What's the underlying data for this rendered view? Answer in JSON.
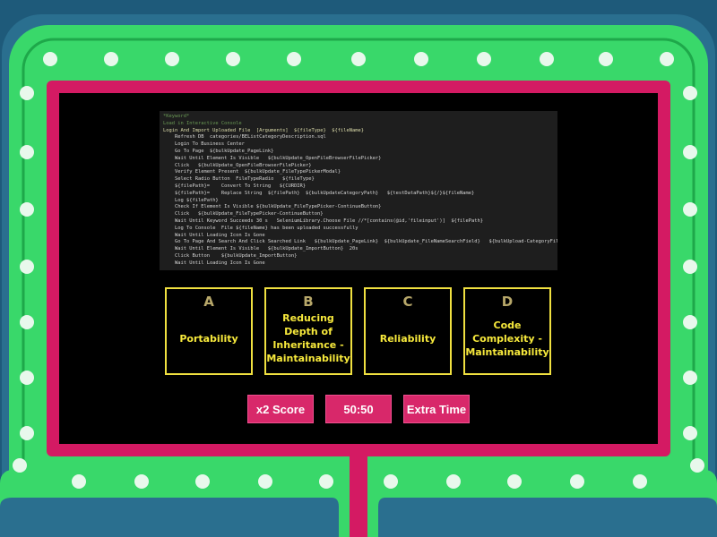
{
  "colors": {
    "background": "#1e5a7a",
    "outer_ring": "#2a6f8f",
    "green_ring": "#39d86a",
    "dark_green": "#1ea84a",
    "pink_frame": "#d41a63",
    "lights": "#e8f8ec",
    "answer_border": "#f0e040",
    "answer_text": "#f7e93c",
    "powerup": "#d8286a"
  },
  "question": {
    "code_lines": [
      {
        "text": "*Keyword*",
        "style": "c-green",
        "indent": 0
      },
      {
        "text": "Load in Interactive Console",
        "style": "c-green",
        "indent": 0
      },
      {
        "text": "Login And Import Uploaded File  [Arguments]  ${fileType}  ${fileName}",
        "style": "c-yellow",
        "indent": 0
      },
      {
        "text": "Refresh DB  categories/BEListCategoryDescription.sql",
        "style": "",
        "indent": 1
      },
      {
        "text": "Login To Business Center",
        "style": "",
        "indent": 1
      },
      {
        "text": "Go To Page  ${bulkUpdate_PageLink}",
        "style": "",
        "indent": 1
      },
      {
        "text": "Wait Until Element Is Visible   ${bulkUpdate_OpenFileBrowserFilePicker}",
        "style": "",
        "indent": 1
      },
      {
        "text": "Click   ${bulkUpdate_OpenFileBrowserFilePicker}",
        "style": "",
        "indent": 1
      },
      {
        "text": "Verify Element Present  ${bulkUpdate_FileTypePickerModal}",
        "style": "",
        "indent": 1
      },
      {
        "text": "Select Radio Button  FileTypeRadio   ${fileType}",
        "style": "",
        "indent": 1
      },
      {
        "text": "${filePath}=    Convert To String   ${CURDIR}",
        "style": "",
        "indent": 1
      },
      {
        "text": "${filePath}=    Replace String  ${filePath}  ${bulkUpdateCategoryPath}   ${testDataPath}${/}${fileName}",
        "style": "",
        "indent": 1
      },
      {
        "text": "Log ${filePath}",
        "style": "",
        "indent": 1
      },
      {
        "text": "Check If Element Is Visible ${bulkUpdate_FileTypePicker-ContinueButton}",
        "style": "",
        "indent": 1
      },
      {
        "text": "Click   ${bulkUpdate_FileTypePicker-ContinueButton}",
        "style": "",
        "indent": 1
      },
      {
        "text": "Wait Until Keyword Succeeds 30 s   SeleniumLibrary.Choose File //*[contains(@id,'fileinput')]  ${filePath}",
        "style": "",
        "indent": 1
      },
      {
        "text": "Log To Console  File ${fileName} has been uploaded successfully",
        "style": "",
        "indent": 1
      },
      {
        "text": "Wait Until Loading Icon Is Gone",
        "style": "",
        "indent": 1
      },
      {
        "text": "Go To Page And Search And Click Searched Link   ${bulkUpdate_PageLink}  ${bulkUpdate_FileNameSearchField}   ${bulkUpload-CategoryFile}",
        "style": "",
        "indent": 1
      },
      {
        "text": "Wait Until Element Is Visible   ${bulkUpdate_ImportButton}  20s",
        "style": "",
        "indent": 1
      },
      {
        "text": "Click Button    ${bulkUpdate_ImportButton}",
        "style": "",
        "indent": 1
      },
      {
        "text": "Wait Until Loading Icon Is Gone",
        "style": "",
        "indent": 1
      }
    ]
  },
  "answers": [
    {
      "letter": "A",
      "text": "Portability"
    },
    {
      "letter": "B",
      "text": "Reducing Depth of Inheritance - Maintainability"
    },
    {
      "letter": "C",
      "text": "Reliability"
    },
    {
      "letter": "D",
      "text": "Code Complexity - Maintainability"
    }
  ],
  "powerups": {
    "double_score": "x2 Score",
    "fifty_fifty": "50:50",
    "extra_time": "Extra Time"
  }
}
